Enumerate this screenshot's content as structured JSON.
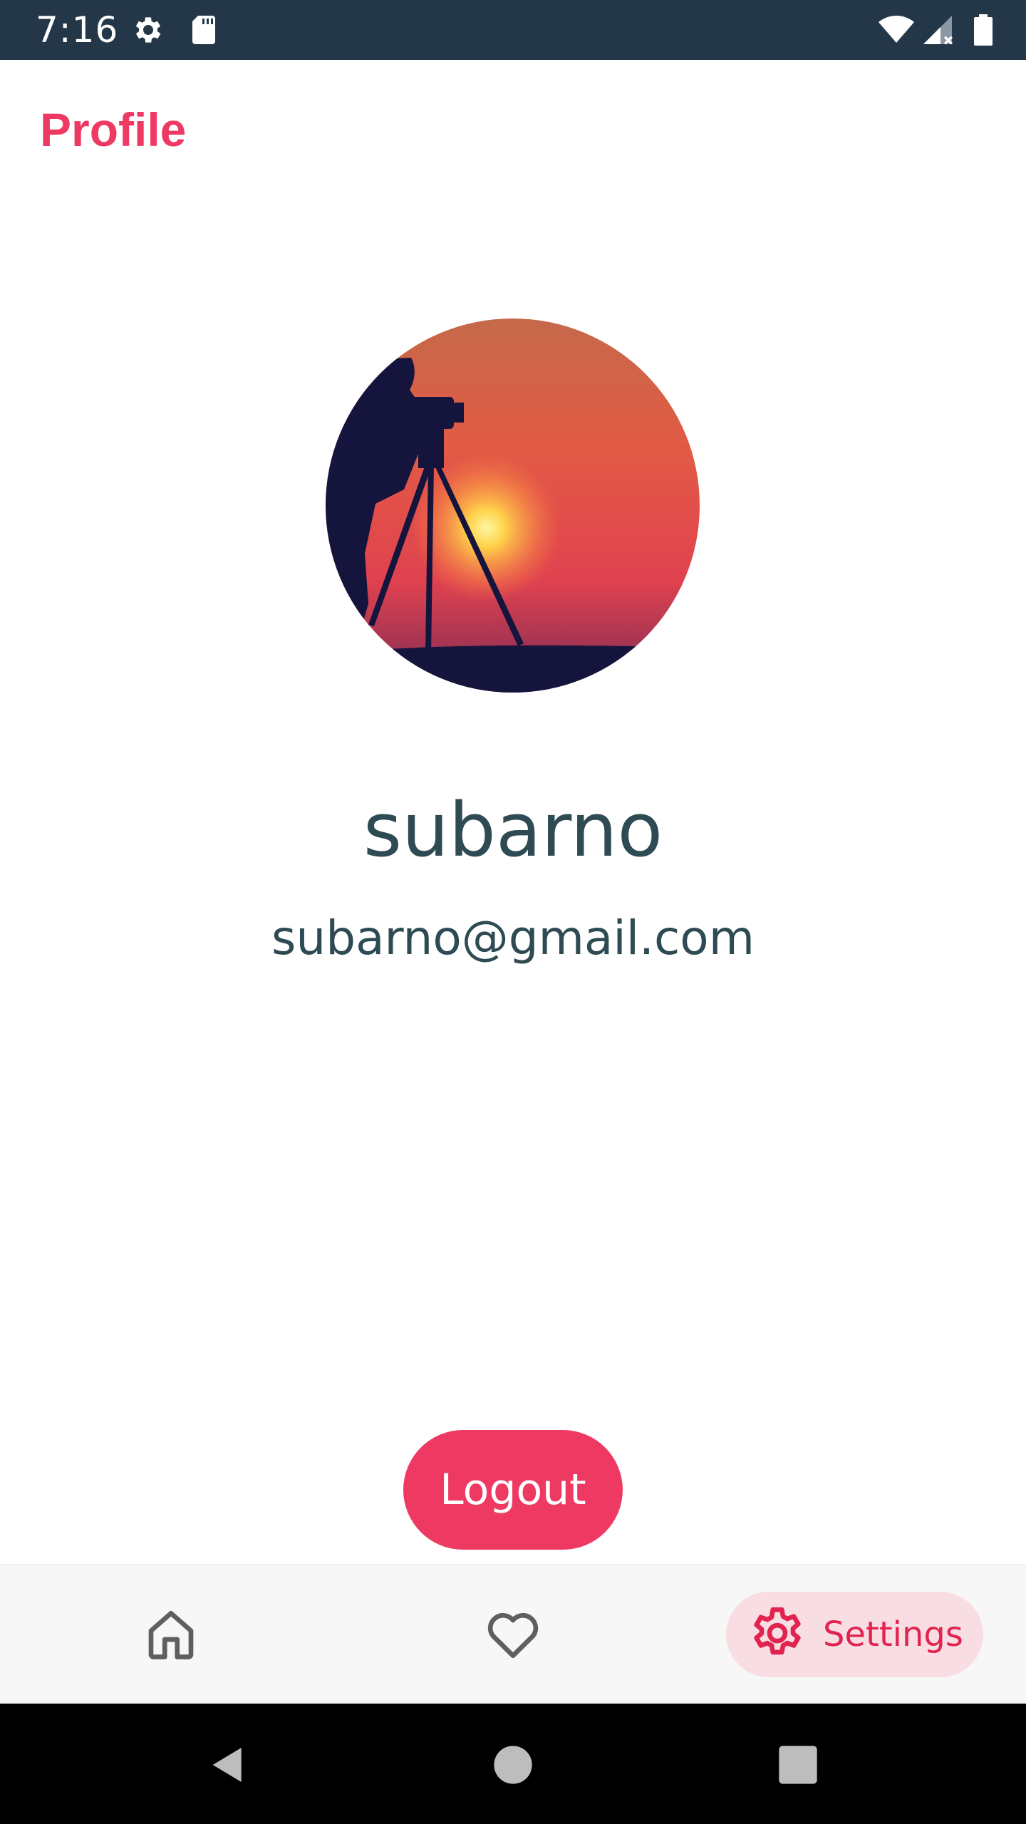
{
  "status_bar": {
    "time": "7:16",
    "icons": [
      "settings-icon",
      "sd-card-icon",
      "wifi-icon",
      "signal-icon",
      "battery-icon"
    ]
  },
  "header": {
    "title": "Profile"
  },
  "profile": {
    "avatar": "photographer-silhouette-sunset",
    "name": "subarno",
    "email": "subarno@gmail.com"
  },
  "actions": {
    "logout_label": "Logout"
  },
  "bottom_nav": {
    "items": [
      {
        "icon": "home-icon",
        "label": "",
        "active": false
      },
      {
        "icon": "heart-icon",
        "label": "",
        "active": false
      },
      {
        "icon": "gear-icon",
        "label": "Settings",
        "active": true
      }
    ]
  },
  "system_nav": {
    "buttons": [
      "back-icon",
      "home-circle-icon",
      "recents-icon"
    ]
  },
  "colors": {
    "accent": "#ee3a62",
    "text_dark": "#2e4a52",
    "status_bar": "#243748",
    "active_nav_bg": "#f8dde3"
  }
}
